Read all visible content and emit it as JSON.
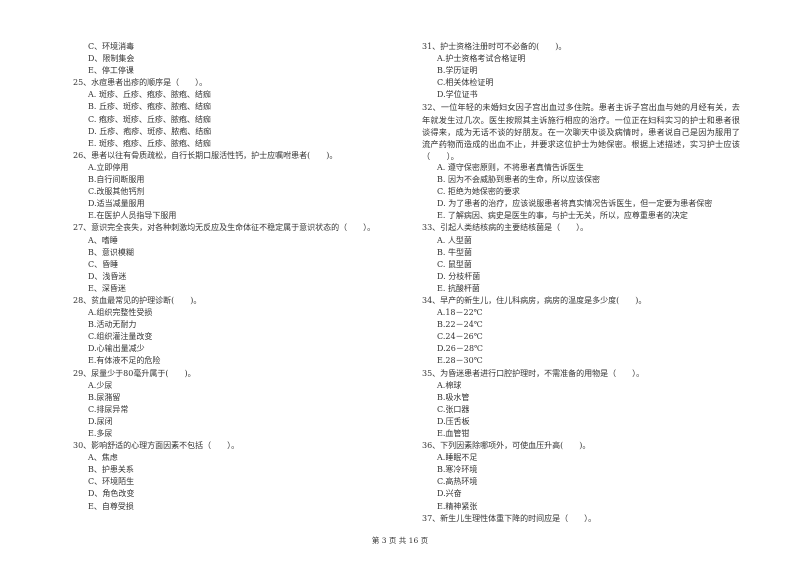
{
  "left_column": [
    {
      "question": null,
      "options": [
        "C、环境消毒",
        "D、限制集会",
        "E、停工停课"
      ]
    },
    {
      "question": "25、水痘患者出疹的顺序是（　　）。",
      "options": [
        "A. 斑疹、丘疹、疱疹、脓疱、结痂",
        "B. 丘疹、斑疹、疱疹、脓疱、结痂",
        "C. 疱疹、斑疹、丘疹、脓疱、结痂",
        "D. 丘疹、疱疹、斑疹、脓疱、结痂",
        "E. 斑疹、疱疹、丘疹、脓疱、结痂"
      ]
    },
    {
      "question": "26、患者以往有骨质疏松，自行长期口服活性钙，护士应嘱咐患者(　　)。",
      "options": [
        "A.立即停用",
        "B.自行间断服用",
        "C.改服其他钙剂",
        "D.适当减量服用",
        "E.在医护人员指导下服用"
      ]
    },
    {
      "question": "27、意识完全丧失，对各种刺激均无反应及生命体征不稳定属于意识状态的（　　）。",
      "options": [
        "A、嗜睡",
        "B、意识模糊",
        "C、昏睡",
        "D、浅昏迷",
        "E、深昏迷"
      ]
    },
    {
      "question": "28、贫血最常见的护理诊断(　　)。",
      "options": [
        "A.组织完整性受损",
        "B.活动无耐力",
        "C.组织灌注量改变",
        "D.心输出量减少",
        "E.有体液不足的危险"
      ]
    },
    {
      "question": "29、尿量少于80毫升属于(　　)。",
      "options": [
        "A.少尿",
        "B.尿潴留",
        "C.排尿异常",
        "D.尿闭",
        "E.多尿"
      ]
    },
    {
      "question": "30、影响舒适的心理方面因素不包括（　　）。",
      "options": [
        "A、焦虑",
        "B、护患关系",
        "C、环境陌生",
        "D、角色改变",
        "E、自尊受损"
      ]
    }
  ],
  "right_column": [
    {
      "question": "31、护士资格注册时可不必备的(　　)。",
      "options": [
        "A.护士资格考试合格证明",
        "B.学历证明",
        "C.相关体检证明",
        "D.学位证书"
      ]
    },
    {
      "question": "32、一位年轻的未婚妇女因子宫出血过多住院。患者主诉子宫出血与她的月经有关，去年就发生过几次。医生按照其主诉施行相应的治疗。一位正在妇科实习的护士和患者很谈得来，成为无话不谈的好朋友。在一次聊天中谈及病情时，患者说自己是因为服用了流产药物而造成的出血不止，并要求这位护士为她保密。根据上述描述，实习护士应该（　　）。",
      "wrap": true,
      "options": [
        "A. 遵守保密原则，不将患者真情告诉医生",
        "B. 因为不会威胁到患者的生命，所以应该保密",
        "C. 拒绝为她保密的要求",
        "D. 为了患者的治疗，应该说服患者将真实情况告诉医生，但一定要为患者保密",
        "E. 了解病因、病史是医生的事，与护士无关，所以，应尊重患者的决定"
      ]
    },
    {
      "question": "33、引起人类结核病的主要结核菌是（　　）。",
      "options": [
        "A. 人型菌",
        "B. 牛型菌",
        "C. 鼠型菌",
        "D. 分枝杆菌",
        "E. 抗酸杆菌"
      ]
    },
    {
      "question": "34、早产的新生儿，住儿科病房，病房的温度是多少度(　　)。",
      "options": [
        "A.18－22℃",
        "B.22－24℃",
        "C.24－26℃",
        "D.26－28℃",
        "E.28－30℃"
      ]
    },
    {
      "question": "35、为昏迷患者进行口腔护理时，不需准备的用物是（　　）。",
      "options": [
        "A.棉球",
        "B.吸水管",
        "C.张口器",
        "D.压舌板",
        "E.血管钳"
      ]
    },
    {
      "question": "36、下列因素除哪项外，可使血压升高(　　)。",
      "options": [
        "A.睡眠不足",
        "B.寒冷环境",
        "C.高热环境",
        "D.兴奋",
        "E.精神紧张"
      ]
    },
    {
      "question": "37、新生儿生理性体重下降的时间应是（　　）。",
      "options": []
    }
  ],
  "footer": {
    "page_label": "第 3 页 共 16 页"
  }
}
